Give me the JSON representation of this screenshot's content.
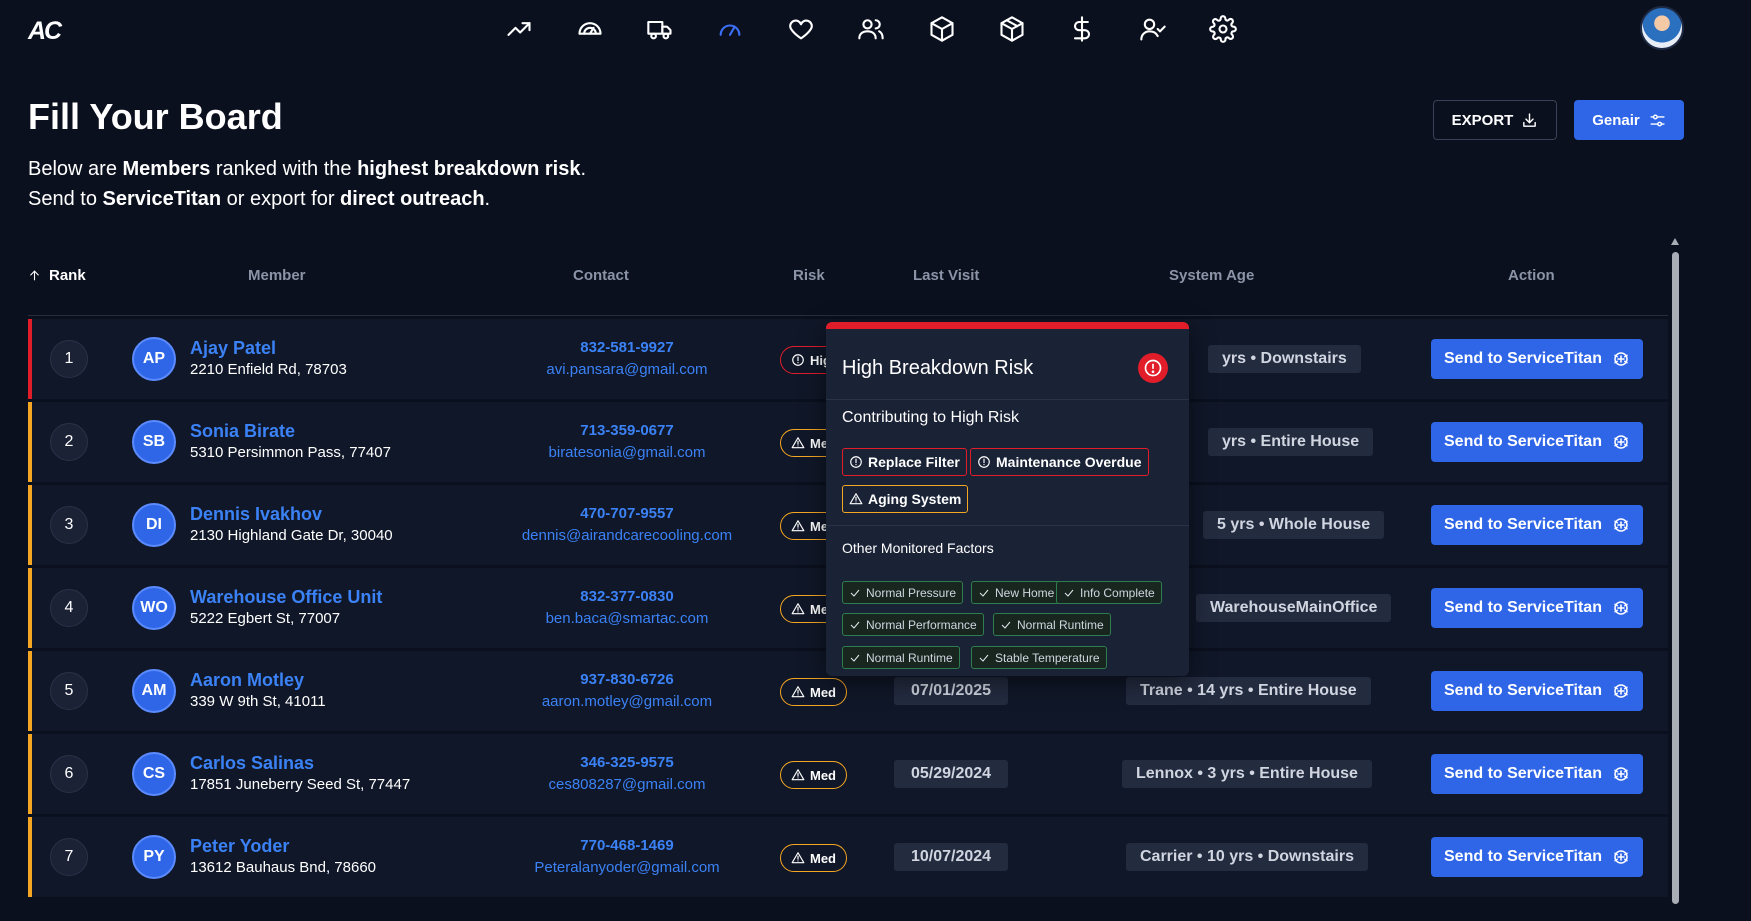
{
  "app": {
    "logo": "AC"
  },
  "nav": {
    "icons": [
      "trending-up-icon",
      "gauge-dashboard-icon",
      "truck-icon",
      "speedometer-icon",
      "heart-icon",
      "users-icon",
      "box-icon",
      "package-icon",
      "dollar-icon",
      "user-check-icon",
      "gear-icon"
    ],
    "active": "speedometer-icon"
  },
  "header": {
    "title": "Fill Your Board",
    "line1": {
      "a": "Below are ",
      "b": "Members",
      "c": " ranked with the ",
      "d": "highest breakdown risk",
      "e": "."
    },
    "line2": {
      "a": "Send to ",
      "b": "ServiceTitan",
      "c": " or export for ",
      "d": "direct outreach",
      "e": "."
    },
    "export_label": "EXPORT",
    "genair_label": "Genair"
  },
  "table": {
    "headers": {
      "rank": "Rank",
      "member": "Member",
      "contact": "Contact",
      "risk": "Risk",
      "last_visit": "Last Visit",
      "system_age": "System Age",
      "action": "Action"
    },
    "send_label": "Send to ServiceTitan",
    "rows": [
      {
        "rank": "1",
        "initials": "AP",
        "name": "Ajay Patel",
        "address": "2210 Enfield Rd, 78703",
        "phone": "832-581-9927",
        "email": "avi.pansara@gmail.com",
        "risk": "High",
        "risk_level": "high",
        "last_visit": "",
        "system": "yrs • Downstairs"
      },
      {
        "rank": "2",
        "initials": "SB",
        "name": "Sonia Birate",
        "address": "5310 Persimmon Pass, 77407",
        "phone": "713-359-0677",
        "email": "biratesonia@gmail.com",
        "risk": "Med",
        "risk_level": "med",
        "last_visit": "",
        "system": "yrs • Entire House"
      },
      {
        "rank": "3",
        "initials": "DI",
        "name": "Dennis Ivakhov",
        "address": "2130 Highland Gate Dr, 30040",
        "phone": "470-707-9557",
        "email": "dennis@airandcarecooling.com",
        "risk": "Med",
        "risk_level": "med",
        "last_visit": "",
        "system": "5 yrs • Whole House"
      },
      {
        "rank": "4",
        "initials": "WO",
        "name": "Warehouse Office Unit",
        "address": "5222 Egbert St, 77007",
        "phone": "832-377-0830",
        "email": "ben.baca@smartac.com",
        "risk": "Med",
        "risk_level": "med",
        "last_visit": "",
        "system": "WarehouseMainOffice"
      },
      {
        "rank": "5",
        "initials": "AM",
        "name": "Aaron Motley",
        "address": "339 W 9th St, 41011",
        "phone": "937-830-6726",
        "email": "aaron.motley@gmail.com",
        "risk": "Med",
        "risk_level": "med",
        "last_visit": "07/01/2025",
        "system": "Trane • 14 yrs • Entire House"
      },
      {
        "rank": "6",
        "initials": "CS",
        "name": "Carlos Salinas",
        "address": "17851 Juneberry Seed St, 77447",
        "phone": "346-325-9575",
        "email": "ces808287@gmail.com",
        "risk": "Med",
        "risk_level": "med",
        "last_visit": "05/29/2024",
        "system": "Lennox • 3 yrs • Entire House"
      },
      {
        "rank": "7",
        "initials": "PY",
        "name": "Peter Yoder",
        "address": "13612 Bauhaus Bnd, 78660",
        "phone": "770-468-1469",
        "email": "Peteralanyoder@gmail.com",
        "risk": "Med",
        "risk_level": "med",
        "last_visit": "10/07/2024",
        "system": "Carrier • 10 yrs • Downstairs"
      }
    ]
  },
  "popover": {
    "title": "High Breakdown Risk",
    "contributing_title": "Contributing to High Risk",
    "contributing": [
      "Replace Filter",
      "Maintenance Overdue",
      "Aging System"
    ],
    "other_title": "Other Monitored Factors",
    "other": [
      "Normal Pressure",
      "New Home",
      "Info Complete",
      "Normal Performance",
      "Normal Runtime",
      "Normal Runtime",
      "Stable Temperature"
    ]
  },
  "colors": {
    "accent": "#2f66e8",
    "link": "#3b82f6",
    "high": "#e11d2a",
    "med": "#f5a623",
    "ok": "#2e7d4f",
    "bg": "#0b101e",
    "row": "#101728"
  }
}
